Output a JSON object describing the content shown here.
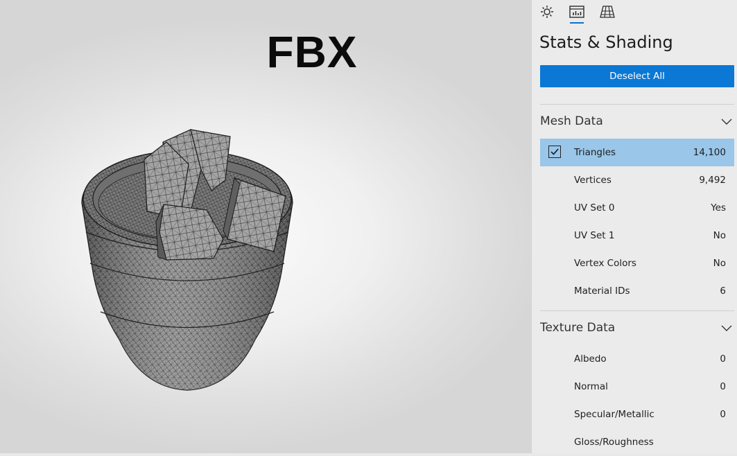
{
  "viewport": {
    "overlay_title": "FBX"
  },
  "panel": {
    "tabs": [
      {
        "id": "lighting",
        "icon": "sun-icon",
        "active": false
      },
      {
        "id": "stats",
        "icon": "stats-chart-icon",
        "active": true
      },
      {
        "id": "grid",
        "icon": "grid-floor-icon",
        "active": false
      }
    ],
    "title": "Stats & Shading",
    "deselect_label": "Deselect All",
    "mesh_section": {
      "label": "Mesh Data",
      "rows": [
        {
          "label": "Triangles",
          "value": "14,100",
          "selected": true
        },
        {
          "label": "Vertices",
          "value": "9,492"
        },
        {
          "label": "UV Set 0",
          "value": "Yes"
        },
        {
          "label": "UV Set 1",
          "value": "No"
        },
        {
          "label": "Vertex Colors",
          "value": "No"
        },
        {
          "label": "Material IDs",
          "value": "6"
        }
      ]
    },
    "texture_section": {
      "label": "Texture Data",
      "rows": [
        {
          "label": "Albedo",
          "value": "0"
        },
        {
          "label": "Normal",
          "value": "0"
        },
        {
          "label": "Specular/Metallic",
          "value": "0"
        },
        {
          "label": "Gloss/Roughness",
          "value": ""
        }
      ]
    }
  },
  "colors": {
    "accent": "#0a78d4",
    "selected_row": "#99c6e9",
    "panel_bg": "#ebebeb"
  }
}
